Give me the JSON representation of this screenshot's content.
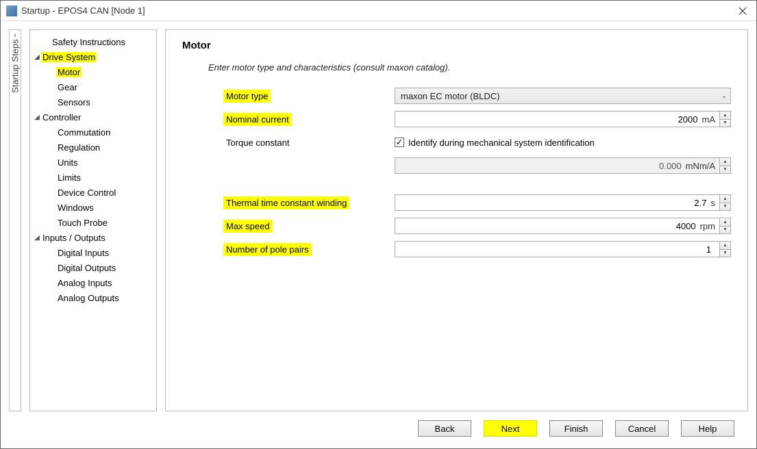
{
  "window": {
    "title": "Startup - EPOS4 CAN [Node 1]"
  },
  "side_tab": {
    "label": "Startup Steps"
  },
  "tree": {
    "safety": "Safety Instructions",
    "drive_system": "Drive System",
    "motor": "Motor",
    "gear": "Gear",
    "sensors": "Sensors",
    "controller": "Controller",
    "commutation": "Commutation",
    "regulation": "Regulation",
    "units": "Units",
    "limits": "Limits",
    "device_control": "Device Control",
    "windows": "Windows",
    "touch_probe": "Touch Probe",
    "io": "Inputs / Outputs",
    "digital_in": "Digital Inputs",
    "digital_out": "Digital Outputs",
    "analog_in": "Analog Inputs",
    "analog_out": "Analog Outputs"
  },
  "main": {
    "heading": "Motor",
    "subtitle": "Enter motor type and characteristics (consult maxon catalog).",
    "labels": {
      "motor_type": "Motor type",
      "nominal_current": "Nominal current",
      "torque_constant": "Torque constant",
      "identify_chk": "Identify during mechanical system identification",
      "thermal": "Thermal time constant winding",
      "max_speed": "Max speed",
      "pole_pairs": "Number of pole pairs"
    },
    "values": {
      "motor_type": "maxon EC motor (BLDC)",
      "nominal_current": "2000",
      "nominal_current_unit": "mA",
      "torque_constant": "0.000",
      "torque_constant_unit": "mNm/A",
      "identify_checked": "✓",
      "thermal": "2.7",
      "thermal_unit": "s",
      "max_speed": "4000",
      "max_speed_unit": "rpm",
      "pole_pairs": "1"
    }
  },
  "buttons": {
    "back": "Back",
    "next": "Next",
    "finish": "Finish",
    "cancel": "Cancel",
    "help": "Help"
  }
}
